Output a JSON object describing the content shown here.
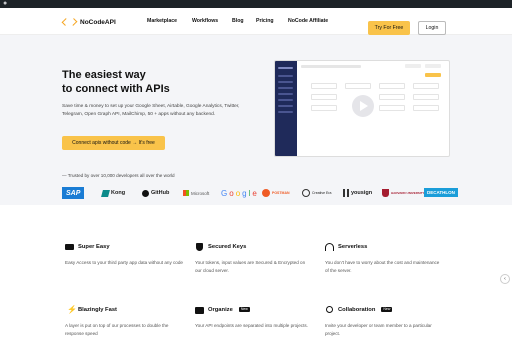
{
  "header": {
    "brand": "NoCodeAPI",
    "nav": [
      "Marketplace",
      "Workflows",
      "Blog",
      "Pricing",
      "NoCode Affiliate"
    ],
    "try_free": "Try For Free",
    "login": "Login"
  },
  "hero": {
    "title_line1": "The easiest way",
    "title_line2": "to connect with APIs",
    "description": "Save time & money to set up your Google Sheet, Airtable, Google Analytics, Twitter, Telegram, Open Graph API, MailChimp, 50 + apps without any backend.",
    "cta": "Connect apis without code → It's free"
  },
  "trusted": {
    "text": "— Trusted by over 10,000 developers all over the world",
    "logos": [
      "SAP",
      "Kong",
      "GitHub",
      "Microsoft",
      "Google",
      "POSTMAN",
      "Creative Era",
      "yousign",
      "HARVARD UNIVERSITY",
      "DECATHLON"
    ]
  },
  "features": [
    {
      "title": "Super Easy",
      "desc": "Easy Access to your third party app data without any code",
      "new": ""
    },
    {
      "title": "Secured Keys",
      "desc": "Your tokens, input values are Secured & Encrypted on our cloud server.",
      "new": ""
    },
    {
      "title": "Serverless",
      "desc": "You don't have to worry about the cost and maintenance of the server.",
      "new": ""
    },
    {
      "title": "Blazingly Fast",
      "desc": "A layer is put on top of our processes to double the response speed",
      "new": ""
    },
    {
      "title": "Organize",
      "desc": "Your API endpoints are separated into multiple projects.",
      "new": "New"
    },
    {
      "title": "Collaboration",
      "desc": "Invite your developer or team member to a particular project.",
      "new": "New"
    }
  ],
  "colors": {
    "accent": "#f9c34a",
    "brand_icon": "#f6a623",
    "sidebar": "#1f2a5a"
  },
  "side_button": "‹"
}
